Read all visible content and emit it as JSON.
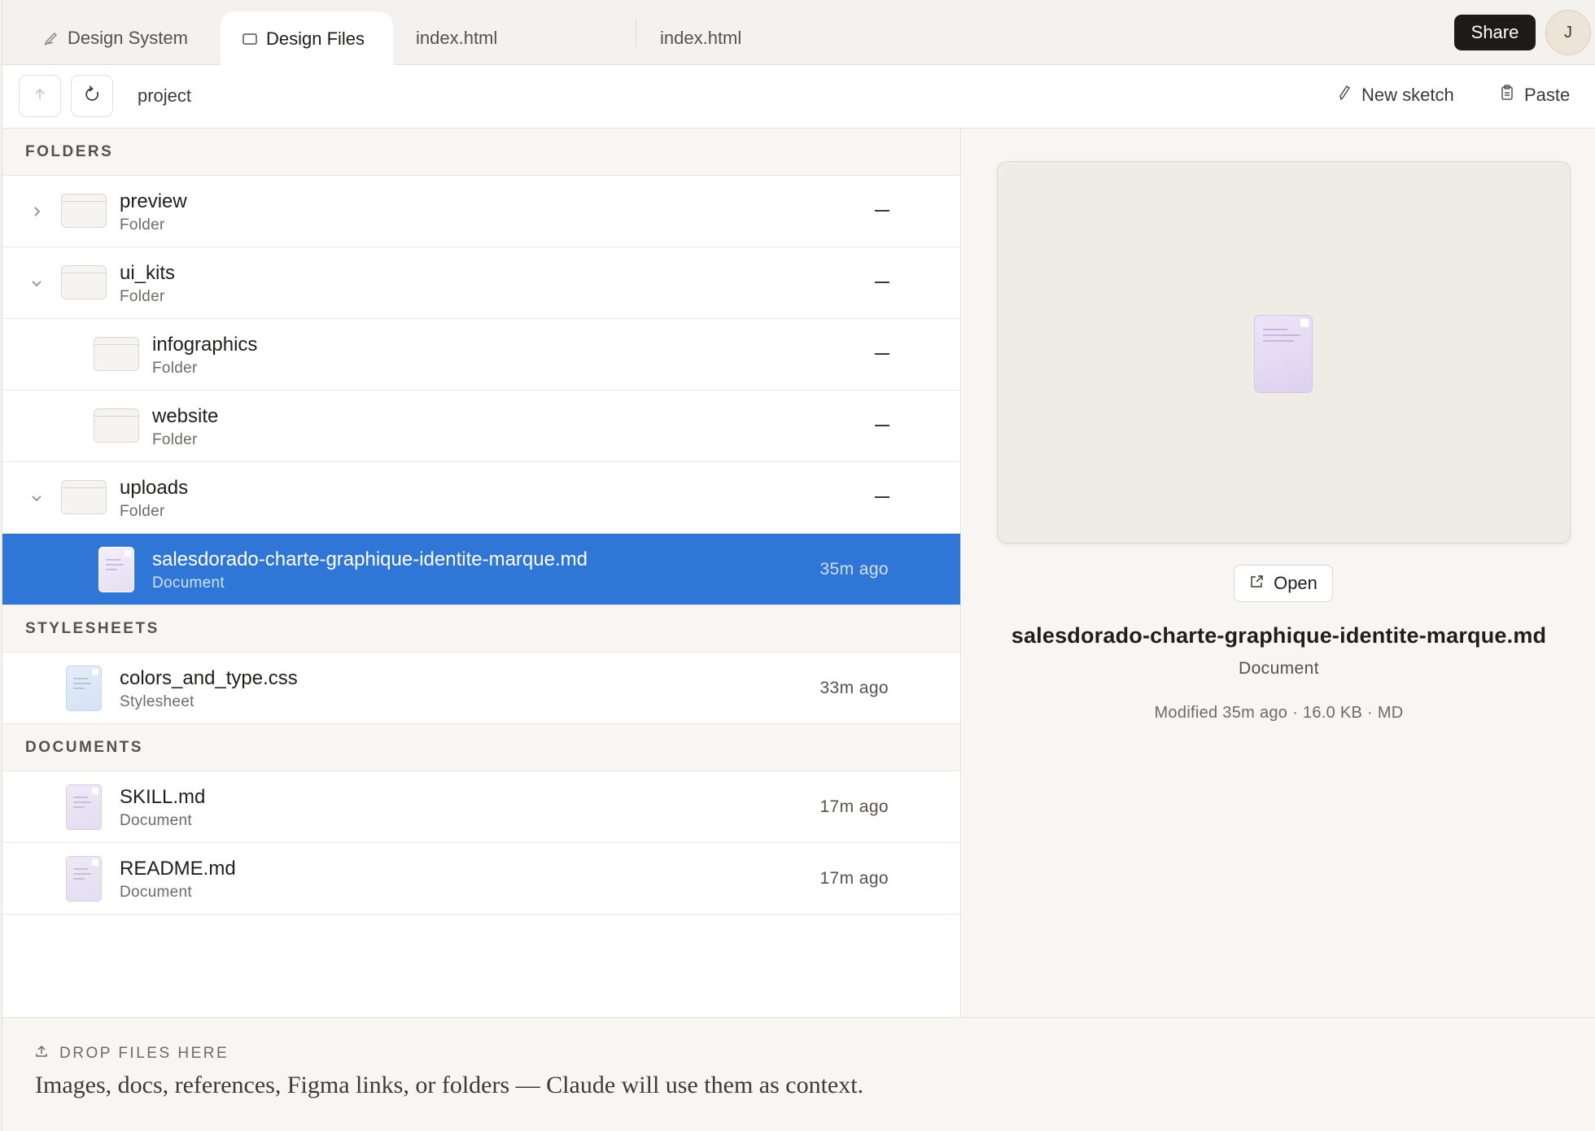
{
  "tabs": [
    {
      "label": "Design System",
      "icon": "pen-icon"
    },
    {
      "label": "Design Files",
      "icon": "folder-icon",
      "active": true
    },
    {
      "label": "index.html"
    },
    {
      "label": "index.html"
    }
  ],
  "header": {
    "share_label": "Share",
    "avatar_initial": "J"
  },
  "toolbar": {
    "breadcrumb": "project",
    "new_sketch_label": "New sketch",
    "paste_label": "Paste"
  },
  "sections": {
    "folders": "FOLDERS",
    "stylesheets": "STYLESHEETS",
    "documents": "DOCUMENTS"
  },
  "folders": [
    {
      "name": "preview",
      "kind": "Folder",
      "date": "—"
    },
    {
      "name": "ui_kits",
      "kind": "Folder",
      "date": "—"
    },
    {
      "name": "infographics",
      "kind": "Folder",
      "date": "—"
    },
    {
      "name": "website",
      "kind": "Folder",
      "date": "—"
    },
    {
      "name": "uploads",
      "kind": "Folder",
      "date": "—"
    },
    {
      "name": "salesdorado-charte-graphique-identite-marque.md",
      "kind": "Document",
      "date": "35m ago"
    }
  ],
  "stylesheets": [
    {
      "name": "colors_and_type.css",
      "kind": "Stylesheet",
      "date": "33m ago"
    }
  ],
  "documents": [
    {
      "name": "SKILL.md",
      "kind": "Document",
      "date": "17m ago"
    },
    {
      "name": "README.md",
      "kind": "Document",
      "date": "17m ago"
    }
  ],
  "preview": {
    "open_label": "Open",
    "title": "salesdorado-charte-graphique-identite-marque.md",
    "kind": "Document",
    "meta": "Modified 35m ago · 16.0 KB · MD"
  },
  "dropzone": {
    "heading": "DROP FILES HERE",
    "text": "Images, docs, references, Figma links, or folders — Claude will use them as context."
  },
  "colors": {
    "accent": "#2f76d6",
    "share_bg": "#1c1b19"
  }
}
